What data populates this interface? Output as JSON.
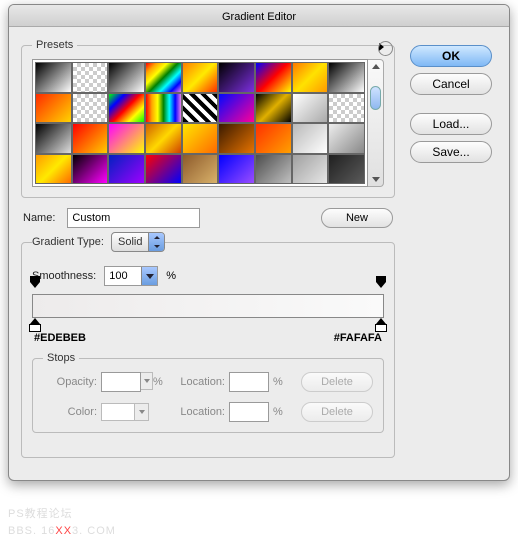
{
  "title": "Gradient Editor",
  "buttons": {
    "ok": "OK",
    "cancel": "Cancel",
    "load": "Load...",
    "save": "Save...",
    "new": "New",
    "delete": "Delete"
  },
  "presets": {
    "legend": "Presets",
    "swatches": [
      "linear-gradient(135deg,#000,#fff)",
      "repeating-conic-gradient(#ccc 0 25%,#fff 0 50%) 0 0/8px 8px",
      "linear-gradient(135deg,#000,#fff)",
      "linear-gradient(135deg,red,orange,yellow,green,cyan,blue,violet)",
      "linear-gradient(135deg,#ff8000,#ffea00,#ff3000)",
      "linear-gradient(135deg,#000,#7d2fe0)",
      "linear-gradient(135deg,#0000ff,#ff0000,#ffff00)",
      "linear-gradient(135deg,#ff7a00,#ffe200,#ff9a00)",
      "linear-gradient(135deg,#000,#fff)",
      "linear-gradient(135deg,#ff2a00,#ffd400)",
      "repeating-conic-gradient(#ccc 0 25%,#fff 0 50%) 0 0/8px 8px",
      "linear-gradient(135deg,#00ff00,#0000ff,#ff0000,#ffff00,#00ff00)",
      "linear-gradient(90deg,red,orange,yellow,green,cyan,blue,violet)",
      "repeating-linear-gradient(45deg,#000 0 4px,#fff 4px 8px)",
      "linear-gradient(135deg,#0008ff,#ff0099)",
      "linear-gradient(135deg,#000,#e0b000,#000)",
      "linear-gradient(135deg,#fff,#aaa)",
      "repeating-conic-gradient(#ccc 0 25%,#fff 0 50%) 0 0/8px 8px",
      "linear-gradient(135deg,#000,#dedede)",
      "linear-gradient(135deg,#ff0000,#ffcc00)",
      "linear-gradient(135deg,#ff00ff,#ffff00)",
      "linear-gradient(135deg,#d06000,#ffd800,#d04000)",
      "linear-gradient(135deg,#ffe600,#ff6a00)",
      "linear-gradient(135deg,#3a1a00,#e67300)",
      "linear-gradient(135deg,#ff3000,#ffa000)",
      "linear-gradient(135deg,#b9b9b9,#fff)",
      "linear-gradient(135deg,#ededed,#888)",
      "linear-gradient(135deg,#ff9a00,#ffe900,#ff6a00)",
      "linear-gradient(135deg,#000,#ff00ff)",
      "linear-gradient(135deg,#0020c0,#9f00ff)",
      "linear-gradient(135deg,#ff0000,#0000ff)",
      "linear-gradient(135deg,#8d5a2b,#d9b26a)",
      "linear-gradient(135deg,#0000ff,#9a4dff)",
      "linear-gradient(135deg,#4d4d4d,#c0c0c0)",
      "linear-gradient(135deg,#a0a0a0,#e6e6e6)",
      "linear-gradient(135deg,#202020,#5a5a5a)"
    ]
  },
  "name": {
    "label": "Name:",
    "value": "Custom"
  },
  "gradientType": {
    "label": "Gradient Type:",
    "value": "Solid"
  },
  "smoothness": {
    "label": "Smoothness:",
    "value": "100",
    "unit": "%"
  },
  "gradient": {
    "leftHex": "#EDEBEB",
    "rightHex": "#FAFAFA"
  },
  "stops": {
    "legend": "Stops",
    "opacity": "Opacity:",
    "color": "Color:",
    "location": "Location:",
    "pct": "%"
  },
  "watermark": {
    "a": "PS教程论坛",
    "b": "BBS. 16",
    "c": "XX",
    "d": "3. COM"
  }
}
